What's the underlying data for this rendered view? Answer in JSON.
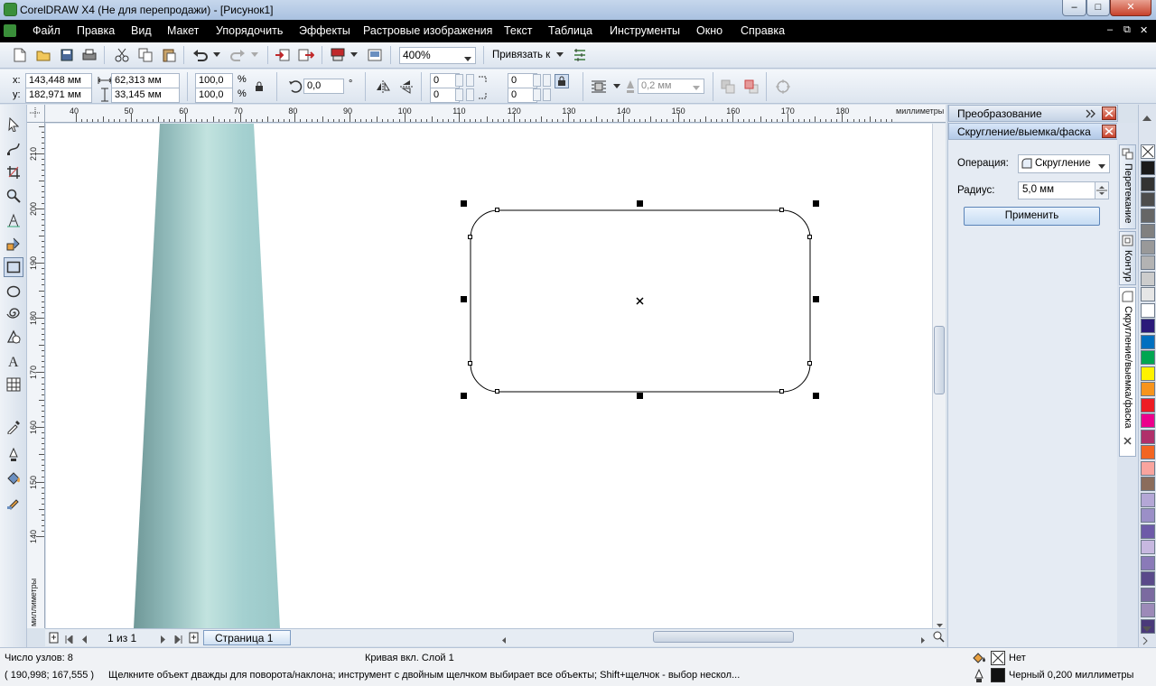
{
  "window": {
    "title": "CorelDRAW X4 (Не для перепродажи) - [Рисунок1]",
    "minimize": "–",
    "restore": "□",
    "close": "✕"
  },
  "menu": {
    "items": [
      "Файл",
      "Правка",
      "Вид",
      "Макет",
      "Упорядочить",
      "Эффекты",
      "Растровые изображения",
      "Текст",
      "Таблица",
      "Инструменты",
      "Окно",
      "Справка"
    ],
    "doc_controls": [
      "–",
      "⧉",
      "✕"
    ]
  },
  "toolbar": {
    "zoom": "400%",
    "snap_label": "Привязать к"
  },
  "propbar": {
    "x_label": "x:",
    "x_value": "143,448 мм",
    "y_label": "y:",
    "y_value": "182,971 мм",
    "w_value": "62,313 мм",
    "h_value": "33,145 мм",
    "scale_x": "100,0",
    "scale_y": "100,0",
    "pct": "%",
    "rotation": "0,0",
    "deg": "°",
    "corner_tl": "0",
    "corner_bl": "0",
    "corner_tr": "0",
    "corner_br": "0",
    "outline_width": "0,2 мм"
  },
  "ruler": {
    "h_labels": [
      "40",
      "50",
      "60",
      "70",
      "80",
      "90",
      "100",
      "110",
      "120",
      "130",
      "140",
      "150",
      "160",
      "170",
      "180"
    ],
    "h_unit": "миллиметры",
    "v_labels": [
      "210",
      "200",
      "190",
      "180",
      "170",
      "160",
      "150",
      "140"
    ],
    "v_unit": "миллиметры"
  },
  "pagenav": {
    "count": "1 из 1",
    "page_tab": "Страница 1"
  },
  "docker": {
    "transform_title": "Преобразование",
    "fillet_title": "Скругление/выемка/фаска",
    "operation_label": "Операция:",
    "operation_value": "Скругление",
    "radius_label": "Радиус:",
    "radius_value": "5,0 мм",
    "apply_button": "Применить",
    "tabs": [
      "Перетекание",
      "Контур",
      "Скругление/выемка/фаска"
    ]
  },
  "palette": {
    "colors": [
      "#1a1a1a",
      "#333333",
      "#4d4d4d",
      "#666666",
      "#808080",
      "#999999",
      "#b3b3b3",
      "#cccccc",
      "#e6e6e6",
      "#ffffff",
      "#2b1a7a",
      "#0070c0",
      "#00a651",
      "#fff200",
      "#f7941d",
      "#ed1c24",
      "#ec008c",
      "#b0306a",
      "#f26522",
      "#f9a49e",
      "#8b6d5c",
      "#b4a7d6",
      "#9b8fc7",
      "#6d5aa8",
      "#c7b8e0",
      "#8a7ab8",
      "#5a4a8a",
      "#7b6aa0",
      "#9c8ab8",
      "#4a3a7a"
    ]
  },
  "status": {
    "nodes": "Число узлов: 8",
    "layer": "Кривая вкл. Слой 1",
    "coords": "( 190,998; 167,555 )",
    "hint": "Щелкните объект дважды для поворота/наклона; инструмент с двойным щелчком выбирает все объекты; Shift+щелчок - выбор нескол...",
    "fill_label": "Нет",
    "outline_label": "Черный  0,200 миллиметры"
  },
  "colors": {
    "menubar": "#000000",
    "accent": "#c6d7ec",
    "shape_gradient": [
      "#7fa6a6",
      "#bde0dc",
      "#9ccaca"
    ]
  }
}
